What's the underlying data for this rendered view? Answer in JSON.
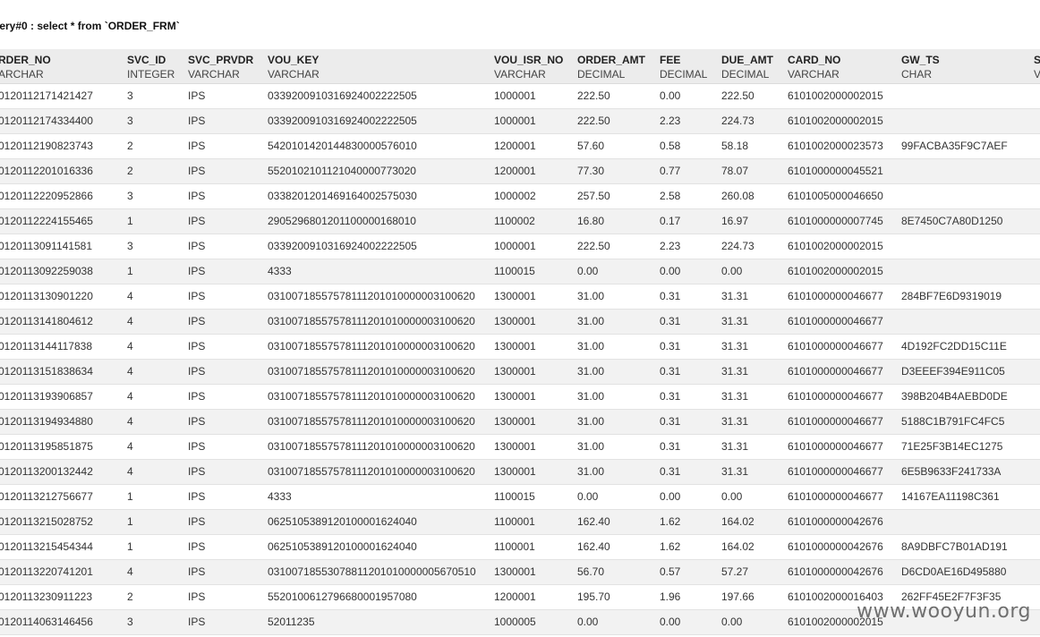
{
  "query": {
    "title": "uery#0 : select * from `ORDER_FRM`"
  },
  "table": {
    "columns": [
      {
        "name": "RDER_NO",
        "type": "ARCHAR"
      },
      {
        "name": "SVC_ID",
        "type": "INTEGER"
      },
      {
        "name": "SVC_PRVDR",
        "type": "VARCHAR"
      },
      {
        "name": "VOU_KEY",
        "type": "VARCHAR"
      },
      {
        "name": "VOU_ISR_NO",
        "type": "VARCHAR"
      },
      {
        "name": "ORDER_AMT",
        "type": "DECIMAL"
      },
      {
        "name": "FEE",
        "type": "DECIMAL"
      },
      {
        "name": "DUE_AMT",
        "type": "DECIMAL"
      },
      {
        "name": "CARD_NO",
        "type": "VARCHAR"
      },
      {
        "name": "GW_TS",
        "type": "CHAR"
      },
      {
        "name": "SI",
        "type": "V"
      }
    ],
    "rows": [
      [
        "0120112171421427",
        "3",
        "IPS",
        "0339200910316924002222505",
        "1000001",
        "222.50",
        "0.00",
        "222.50",
        "6101002000002015",
        "",
        ""
      ],
      [
        "0120112174334400",
        "3",
        "IPS",
        "0339200910316924002222505",
        "1000001",
        "222.50",
        "2.23",
        "224.73",
        "6101002000002015",
        "",
        ""
      ],
      [
        "0120112190823743",
        "2",
        "IPS",
        "5420101420144830000576010",
        "1200001",
        "57.60",
        "0.58",
        "58.18",
        "6101002000023573",
        "99FACBA35F9C7AEF",
        ""
      ],
      [
        "0120112201016336",
        "2",
        "IPS",
        "5520102101121040000773020",
        "1200001",
        "77.30",
        "0.77",
        "78.07",
        "6101000000045521",
        "",
        ""
      ],
      [
        "0120112220952866",
        "3",
        "IPS",
        "0338201201469164002575030",
        "1000002",
        "257.50",
        "2.58",
        "260.08",
        "6101005000046650",
        "",
        ""
      ],
      [
        "0120112224155465",
        "1",
        "IPS",
        "2905296801201100000168010",
        "1100002",
        "16.80",
        "0.17",
        "16.97",
        "6101000000007745",
        "8E7450C7A80D1250",
        ""
      ],
      [
        "0120113091141581",
        "3",
        "IPS",
        "0339200910316924002222505",
        "1000001",
        "222.50",
        "2.23",
        "224.73",
        "6101002000002015",
        "",
        ""
      ],
      [
        "0120113092259038",
        "1",
        "IPS",
        "4333",
        "1100015",
        "0.00",
        "0.00",
        "0.00",
        "6101002000002015",
        "",
        ""
      ],
      [
        "0120113130901220",
        "4",
        "IPS",
        "03100718557578111201010000003100620",
        "1300001",
        "31.00",
        "0.31",
        "31.31",
        "6101000000046677",
        "284BF7E6D9319019",
        ""
      ],
      [
        "0120113141804612",
        "4",
        "IPS",
        "03100718557578111201010000003100620",
        "1300001",
        "31.00",
        "0.31",
        "31.31",
        "6101000000046677",
        "",
        ""
      ],
      [
        "0120113144117838",
        "4",
        "IPS",
        "03100718557578111201010000003100620",
        "1300001",
        "31.00",
        "0.31",
        "31.31",
        "6101000000046677",
        "4D192FC2DD15C11E",
        ""
      ],
      [
        "0120113151838634",
        "4",
        "IPS",
        "03100718557578111201010000003100620",
        "1300001",
        "31.00",
        "0.31",
        "31.31",
        "6101000000046677",
        "D3EEEF394E911C05",
        ""
      ],
      [
        "0120113193906857",
        "4",
        "IPS",
        "03100718557578111201010000003100620",
        "1300001",
        "31.00",
        "0.31",
        "31.31",
        "6101000000046677",
        "398B204B4AEBD0DE",
        ""
      ],
      [
        "0120113194934880",
        "4",
        "IPS",
        "03100718557578111201010000003100620",
        "1300001",
        "31.00",
        "0.31",
        "31.31",
        "6101000000046677",
        "5188C1B791FC4FC5",
        ""
      ],
      [
        "0120113195851875",
        "4",
        "IPS",
        "03100718557578111201010000003100620",
        "1300001",
        "31.00",
        "0.31",
        "31.31",
        "6101000000046677",
        "71E25F3B14EC1275",
        ""
      ],
      [
        "0120113200132442",
        "4",
        "IPS",
        "03100718557578111201010000003100620",
        "1300001",
        "31.00",
        "0.31",
        "31.31",
        "6101000000046677",
        "6E5B9633F241733A",
        ""
      ],
      [
        "0120113212756677",
        "1",
        "IPS",
        "4333",
        "1100015",
        "0.00",
        "0.00",
        "0.00",
        "6101000000046677",
        "14167EA11198C361",
        ""
      ],
      [
        "0120113215028752",
        "1",
        "IPS",
        "0625105389120100001624040",
        "1100001",
        "162.40",
        "1.62",
        "164.02",
        "6101000000042676",
        "",
        ""
      ],
      [
        "0120113215454344",
        "1",
        "IPS",
        "0625105389120100001624040",
        "1100001",
        "162.40",
        "1.62",
        "164.02",
        "6101000000042676",
        "8A9DBFC7B01AD191",
        ""
      ],
      [
        "0120113220741201",
        "4",
        "IPS",
        "03100718553078811201010000005670510",
        "1300001",
        "56.70",
        "0.57",
        "57.27",
        "6101000000042676",
        "D6CD0AE16D495880",
        ""
      ],
      [
        "0120113230911223",
        "2",
        "IPS",
        "5520100612796680001957080",
        "1200001",
        "195.70",
        "1.96",
        "197.66",
        "6101002000016403",
        "262FF45E2F7F3F35",
        ""
      ],
      [
        "0120114063146456",
        "3",
        "IPS",
        "52011235",
        "1000005",
        "0.00",
        "0.00",
        "0.00",
        "6101002000002015",
        "",
        ""
      ]
    ]
  },
  "watermark": {
    "text": "www.wooyun.org"
  }
}
